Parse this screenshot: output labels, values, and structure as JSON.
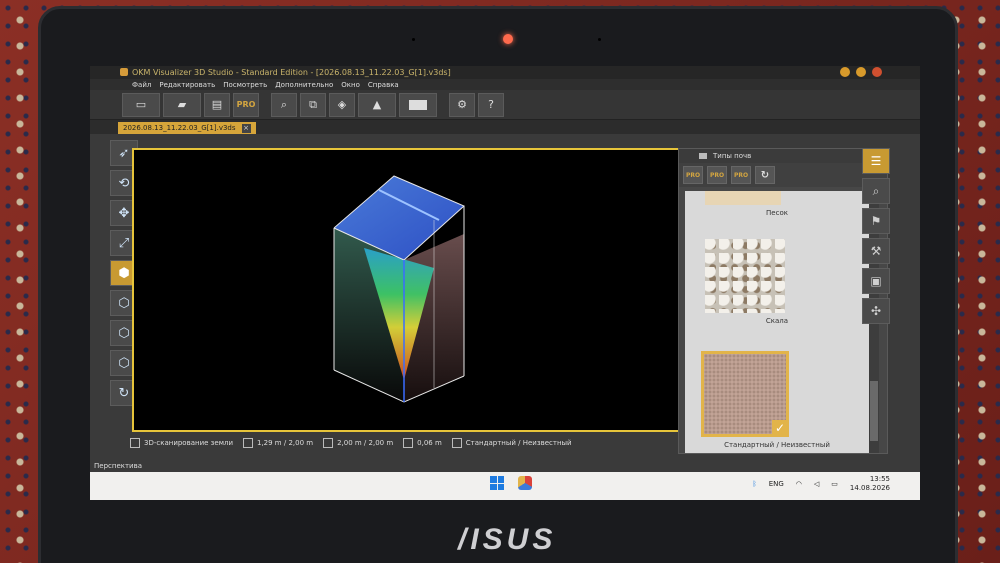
{
  "app": {
    "title": "OKM Visualizer 3D Studio - Standard Edition - [2026.08.13_11.22.03_G[1].v3ds]",
    "accent": "#c89a32",
    "viewport_border": "#e6c43a"
  },
  "menu": [
    "Файл",
    "Редактировать",
    "Посмотреть",
    "Дополнительно",
    "Окно",
    "Справка"
  ],
  "toolbar": {
    "pro_label": "PRO",
    "icons": [
      "new-file-icon",
      "open-folder-icon",
      "save-icon",
      "pro-icon",
      "search-icon",
      "export-icon",
      "cube-view-icon",
      "terrain-icon",
      "color-palette-icon",
      "settings-icon",
      "help-icon"
    ]
  },
  "document_tab": {
    "label": "2026.08.13_11.22.03_G[1].v3ds",
    "close": "×"
  },
  "left_tools": [
    "cursor-icon",
    "rotate-icon",
    "move-icon",
    "zoom-icon",
    "cube-top-icon",
    "cube-side-icon",
    "cube-front-icon",
    "cube-iso-icon",
    "reset-view-icon"
  ],
  "right_tools": [
    "layers-icon",
    "zoom-area-icon",
    "bookmark-icon",
    "measure-icon",
    "screenshot-icon",
    "navigate-icon"
  ],
  "soil_panel": {
    "title": "Типы почв",
    "tool_labels": [
      "PRO",
      "PRO",
      "PRO"
    ],
    "items": [
      {
        "label": "Песок"
      },
      {
        "label": "Скала"
      },
      {
        "label": "Стандартный / Неизвестный",
        "selected": true
      }
    ],
    "selected_check": "✓"
  },
  "status": {
    "scan_mode": "3D-сканирование земли",
    "dim1": "1,29 m / 2,00 m",
    "dim2": "2,00 m / 2,00 m",
    "depth": "0,06 m",
    "soil": "Стандартный / Неизвестный"
  },
  "view_label": "Перспектива",
  "taskbar": {
    "lang": "ENG",
    "time": "13:55",
    "date": "14.08.2026"
  },
  "brand": "/ISUS"
}
